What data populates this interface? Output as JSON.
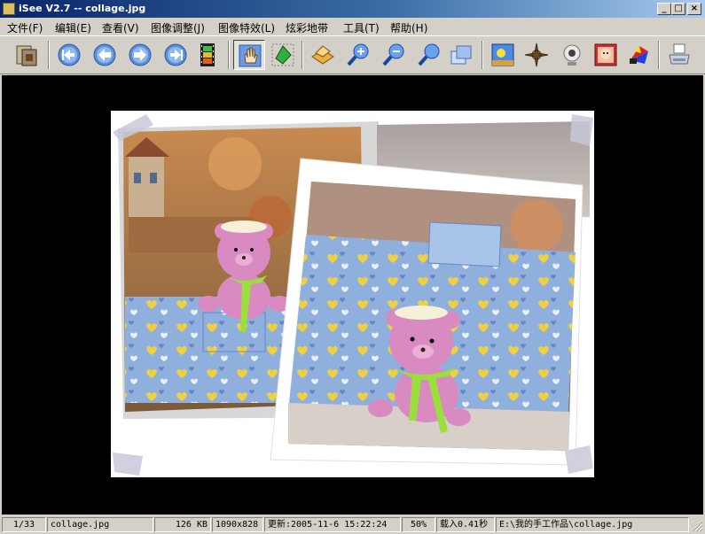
{
  "window": {
    "title": "iSee V2.7 -- collage.jpg",
    "minimize_label": "_",
    "maximize_label": "□",
    "close_label": "×"
  },
  "menu": {
    "items": [
      {
        "label": "文件(F)"
      },
      {
        "label": "编辑(E)"
      },
      {
        "label": "查看(V)"
      },
      {
        "label": "图像调整(J)"
      },
      {
        "label": "图像特效(L)"
      },
      {
        "label": "炫彩地带"
      },
      {
        "label": "工具(T)"
      },
      {
        "label": "帮助(H)"
      }
    ]
  },
  "toolbar": {
    "buttons": [
      {
        "icon": "open-folder-icon"
      },
      {
        "icon": "first-image-icon"
      },
      {
        "icon": "previous-image-icon"
      },
      {
        "icon": "next-image-icon"
      },
      {
        "icon": "last-image-icon"
      },
      {
        "icon": "slideshow-film-icon"
      },
      {
        "icon": "hand-pan-icon",
        "pressed": true
      },
      {
        "icon": "select-crop-icon"
      },
      {
        "icon": "batch-process-icon"
      },
      {
        "icon": "zoom-in-icon"
      },
      {
        "icon": "zoom-out-icon"
      },
      {
        "icon": "zoom-fit-icon"
      },
      {
        "icon": "fullscreen-icon"
      },
      {
        "icon": "wallpaper-icon"
      },
      {
        "icon": "compass-icon"
      },
      {
        "icon": "webcam-icon"
      },
      {
        "icon": "photo-frame-icon"
      },
      {
        "icon": "color-effects-icon"
      },
      {
        "icon": "print-icon"
      }
    ]
  },
  "image": {
    "filename": "collage.jpg",
    "background": "#000000",
    "frame_color": "#ffffff"
  },
  "status": {
    "index": "1/33",
    "filename": "collage.jpg",
    "size": "126 KB",
    "dimensions": "1090x828",
    "modified": "更新:2005-11-6 15:22:24",
    "zoom": "50%",
    "load_time": "载入0.41秒",
    "path": "E:\\我的手工作品\\collage.jpg"
  },
  "colors": {
    "title_start": "#0a246a",
    "title_end": "#a6caf0",
    "chrome": "#d4d0c8",
    "bear_pink": "#d98ac0",
    "scarf_green": "#9be03a",
    "box_blue": "#8fb0dc"
  }
}
